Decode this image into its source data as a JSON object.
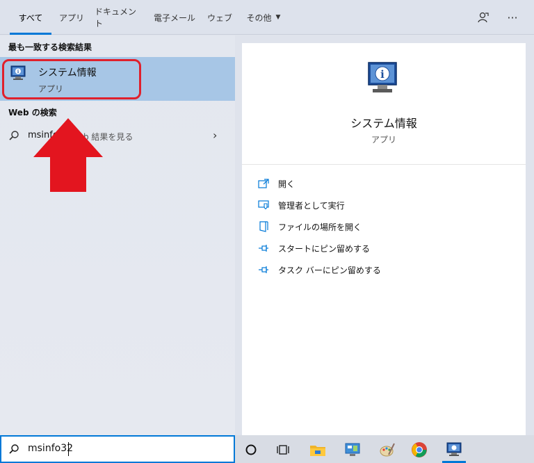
{
  "tabs": [
    {
      "label": "すべて"
    },
    {
      "label": "アプリ"
    },
    {
      "label": "ドキュメント"
    },
    {
      "label": "電子メール"
    },
    {
      "label": "ウェブ"
    },
    {
      "label": "その他"
    }
  ],
  "best_match": {
    "heading": "最も一致する検索結果",
    "title": "システム情報",
    "subtitle": "アプリ"
  },
  "web_search": {
    "heading": "Web の検索",
    "query": "msinfo",
    "suffix": "b 結果を見る"
  },
  "detail": {
    "title": "システム情報",
    "subtitle": "アプリ",
    "actions": [
      {
        "label": "開く"
      },
      {
        "label": "管理者として実行"
      },
      {
        "label": "ファイルの場所を開く"
      },
      {
        "label": "スタートにピン留めする"
      },
      {
        "label": "タスク バーにピン留めする"
      }
    ]
  },
  "search": {
    "value": "msinfo32"
  },
  "colors": {
    "accent": "#0078d7",
    "highlight": "#a7c6e6",
    "annotation": "#e0202c"
  }
}
